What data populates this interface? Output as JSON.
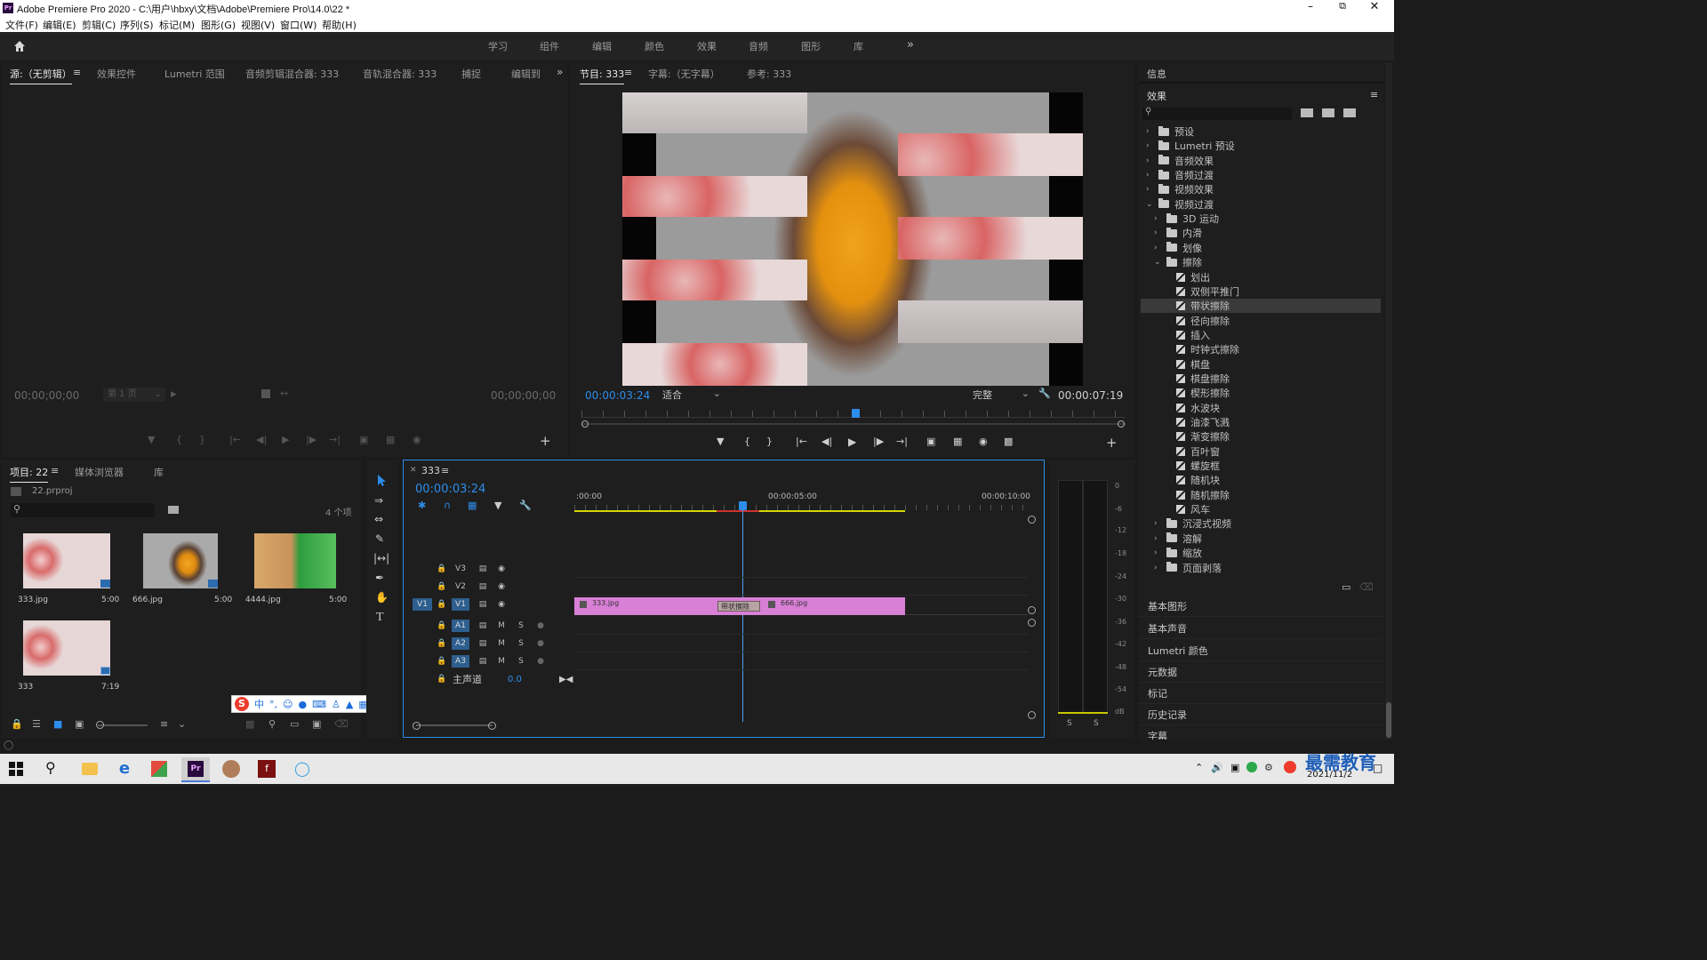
{
  "window": {
    "title": "Adobe Premiere Pro 2020 - C:\\用户\\hbxy\\文档\\Adobe\\Premiere Pro\\14.0\\22 *"
  },
  "menu": [
    "文件(F)",
    "编辑(E)",
    "剪辑(C)",
    "序列(S)",
    "标记(M)",
    "图形(G)",
    "视图(V)",
    "窗口(W)",
    "帮助(H)"
  ],
  "workspaces": [
    "学习",
    "组件",
    "编辑",
    "颜色",
    "效果",
    "音频",
    "图形",
    "库"
  ],
  "source": {
    "tabs": [
      "源:（无剪辑）",
      "效果控件",
      "Lumetri 范围",
      "音频剪辑混合器: 333",
      "音轨混合器: 333",
      "捕捉",
      "编辑到"
    ],
    "timecode_left": "00;00;00;00",
    "timecode_right": "00;00;00;00",
    "page": "第 1 页"
  },
  "program": {
    "tabs": [
      "节目: 333",
      "字幕:（无字幕）",
      "参考: 333"
    ],
    "timecode": "00:00:03:24",
    "fit": "适合",
    "quality": "完整",
    "duration": "00:00:07:19"
  },
  "project": {
    "tabs": [
      "项目: 22",
      "媒体浏览器",
      "库"
    ],
    "file": "22.prproj",
    "count": "4 个项",
    "items": [
      {
        "name": "333.jpg",
        "duration": "5:00"
      },
      {
        "name": "666.jpg",
        "duration": "5:00"
      },
      {
        "name": "4444.jpg",
        "duration": "5:00"
      },
      {
        "name": "333",
        "duration": "7:19"
      }
    ]
  },
  "timeline": {
    "tab": "333",
    "timecode": "00:00:03:24",
    "ruler": [
      ":00:00",
      "00:00:05:00",
      "00:00:10:00"
    ],
    "video_tracks": [
      "V3",
      "V2",
      "V1"
    ],
    "audio_tracks": [
      "A1",
      "A2",
      "A3"
    ],
    "source_patch": "V1",
    "master_label": "主声道",
    "master_value": "0.0",
    "clips": [
      {
        "name": "333.jpg"
      },
      {
        "name": "带状擦除"
      },
      {
        "name": "666.jpg"
      }
    ]
  },
  "meter": {
    "ticks": [
      "0",
      "-6",
      "-12",
      "-18",
      "-24",
      "-30",
      "-36",
      "-42",
      "-48",
      "-54",
      "dB"
    ],
    "solo_left": "S",
    "solo_right": "S"
  },
  "right_panel": {
    "info_label": "信息",
    "effects_label": "效果",
    "tree": [
      {
        "label": "预设",
        "level": 0,
        "kind": "folder",
        "expanded": false
      },
      {
        "label": "Lumetri 预设",
        "level": 0,
        "kind": "folder",
        "expanded": false
      },
      {
        "label": "音频效果",
        "level": 0,
        "kind": "folder",
        "expanded": false
      },
      {
        "label": "音频过渡",
        "level": 0,
        "kind": "folder",
        "expanded": false
      },
      {
        "label": "视频效果",
        "level": 0,
        "kind": "folder",
        "expanded": false
      },
      {
        "label": "视频过渡",
        "level": 0,
        "kind": "folder",
        "expanded": true
      },
      {
        "label": "3D 运动",
        "level": 1,
        "kind": "folder",
        "expanded": false
      },
      {
        "label": "内滑",
        "level": 1,
        "kind": "folder",
        "expanded": false
      },
      {
        "label": "划像",
        "level": 1,
        "kind": "folder",
        "expanded": false
      },
      {
        "label": "擦除",
        "level": 1,
        "kind": "folder",
        "expanded": true
      },
      {
        "label": "划出",
        "level": 2,
        "kind": "fx"
      },
      {
        "label": "双侧平推门",
        "level": 2,
        "kind": "fx"
      },
      {
        "label": "带状擦除",
        "level": 2,
        "kind": "fx",
        "selected": true
      },
      {
        "label": "径向擦除",
        "level": 2,
        "kind": "fx"
      },
      {
        "label": "插入",
        "level": 2,
        "kind": "fx"
      },
      {
        "label": "时钟式擦除",
        "level": 2,
        "kind": "fx"
      },
      {
        "label": "棋盘",
        "level": 2,
        "kind": "fx"
      },
      {
        "label": "棋盘擦除",
        "level": 2,
        "kind": "fx"
      },
      {
        "label": "楔形擦除",
        "level": 2,
        "kind": "fx"
      },
      {
        "label": "水波块",
        "level": 2,
        "kind": "fx"
      },
      {
        "label": "油漆飞溅",
        "level": 2,
        "kind": "fx"
      },
      {
        "label": "渐变擦除",
        "level": 2,
        "kind": "fx"
      },
      {
        "label": "百叶窗",
        "level": 2,
        "kind": "fx"
      },
      {
        "label": "螺旋框",
        "level": 2,
        "kind": "fx"
      },
      {
        "label": "随机块",
        "level": 2,
        "kind": "fx"
      },
      {
        "label": "随机擦除",
        "level": 2,
        "kind": "fx"
      },
      {
        "label": "风车",
        "level": 2,
        "kind": "fx"
      },
      {
        "label": "沉浸式视频",
        "level": 1,
        "kind": "folder",
        "expanded": false
      },
      {
        "label": "溶解",
        "level": 1,
        "kind": "folder",
        "expanded": false
      },
      {
        "label": "缩放",
        "level": 1,
        "kind": "folder",
        "expanded": false
      },
      {
        "label": "页面剥落",
        "level": 1,
        "kind": "folder",
        "expanded": false
      }
    ],
    "sections": [
      "基本图形",
      "基本声音",
      "Lumetri 颜色",
      "元数据",
      "标记",
      "历史记录",
      "字幕"
    ]
  },
  "ime": {
    "lang": "中"
  },
  "taskbar": {
    "date": "2021/11/2"
  },
  "watermark": "最需教育",
  "colors": {
    "accent": "#2d8ceb",
    "clip": "#d87fd6",
    "work_area": "#d6d600",
    "playhead": "#4c9ff0"
  }
}
